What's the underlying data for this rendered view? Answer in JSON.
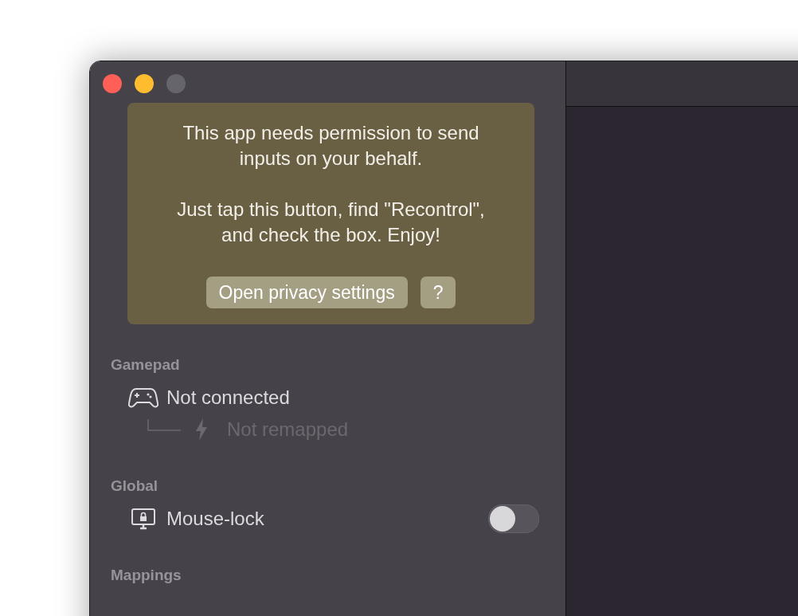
{
  "window": {
    "buttons": [
      {
        "kind": "close"
      },
      {
        "kind": "minimize"
      },
      {
        "kind": "zoom"
      }
    ]
  },
  "notice": {
    "paragraphs": [
      "This app needs permission to send inputs on your behalf.",
      "Just tap this button, find \"Recontrol\", and check the box. Enjoy!"
    ],
    "buttons": [
      "Open privacy settings",
      "?"
    ]
  },
  "sections": [
    {
      "title": "Gamepad",
      "rows": [
        {
          "kind": "device",
          "label": "Not connected",
          "disabled": false,
          "children": [
            {
              "kind": "remap",
              "label": "Not remapped",
              "disabled": true
            }
          ]
        }
      ]
    },
    {
      "title": "Global",
      "rows": [
        {
          "kind": "toggle",
          "label": "Mouse-lock",
          "disabled": false,
          "on": false
        }
      ]
    },
    {
      "title": "Mappings"
    }
  ]
}
